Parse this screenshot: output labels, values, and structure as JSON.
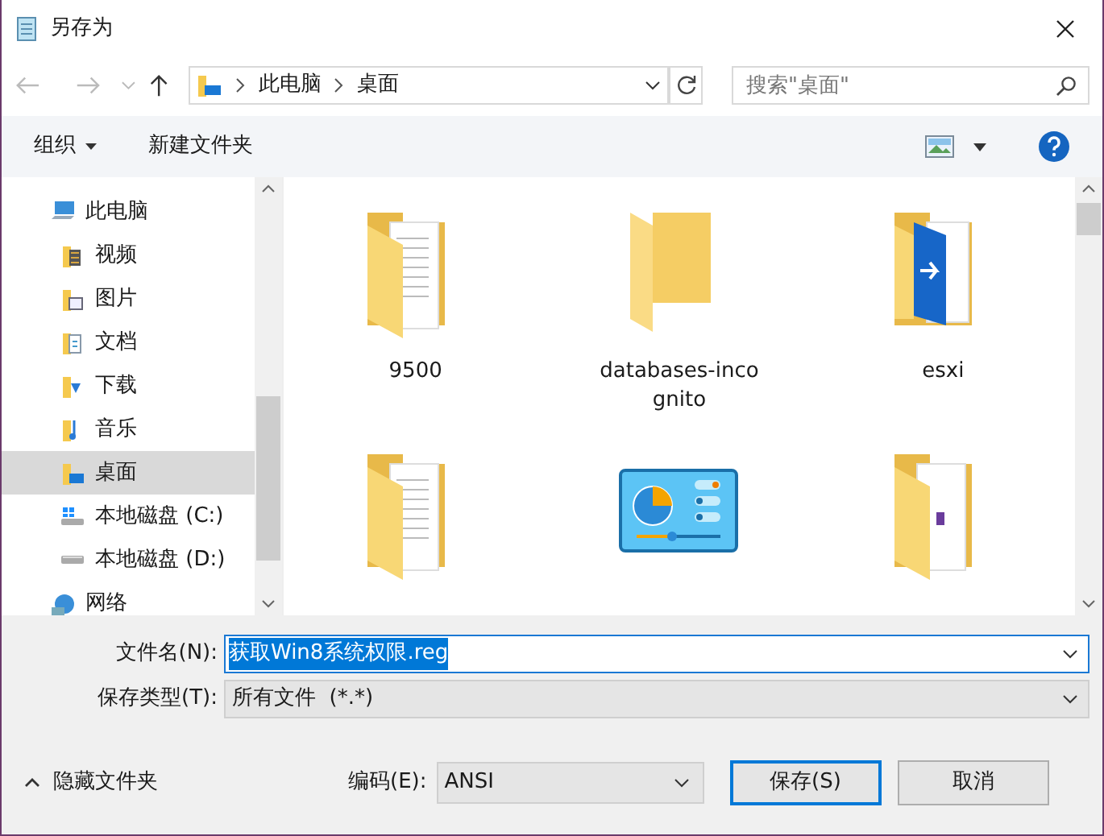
{
  "window": {
    "title": "另存为"
  },
  "breadcrumb": [
    "此电脑",
    "桌面"
  ],
  "search": {
    "placeholder": "搜索\"桌面\""
  },
  "toolbar": {
    "organize": "组织",
    "new_folder": "新建文件夹"
  },
  "sidebar": {
    "items": [
      {
        "label": "此电脑",
        "kind": "pc",
        "selected": false
      },
      {
        "label": "视频",
        "kind": "video",
        "selected": false
      },
      {
        "label": "图片",
        "kind": "pictures",
        "selected": false
      },
      {
        "label": "文档",
        "kind": "documents",
        "selected": false
      },
      {
        "label": "下载",
        "kind": "downloads",
        "selected": false
      },
      {
        "label": "音乐",
        "kind": "music",
        "selected": false
      },
      {
        "label": "桌面",
        "kind": "desktop",
        "selected": true
      },
      {
        "label": "本地磁盘 (C:)",
        "kind": "drive-c",
        "selected": false
      },
      {
        "label": "本地磁盘 (D:)",
        "kind": "drive",
        "selected": false
      },
      {
        "label": "网络",
        "kind": "network",
        "selected": false
      }
    ]
  },
  "files": [
    {
      "name": "9500",
      "kind": "folder-docs"
    },
    {
      "name": "databases-inco\ngnito",
      "kind": "folder"
    },
    {
      "name": "esxi",
      "kind": "folder-app"
    },
    {
      "kind": "folder-docs"
    },
    {
      "kind": "control-panel"
    },
    {
      "kind": "folder-file"
    }
  ],
  "form": {
    "filename_label": "文件名(N):",
    "filename": "获取Win8系统权限.reg",
    "type_label": "保存类型(T):",
    "type": "所有文件  (*.*)",
    "encoding_label": "编码(E):",
    "encoding": "ANSI"
  },
  "hide_folders": "隐藏文件夹",
  "buttons": [
    "保存(S)",
    "取消"
  ]
}
